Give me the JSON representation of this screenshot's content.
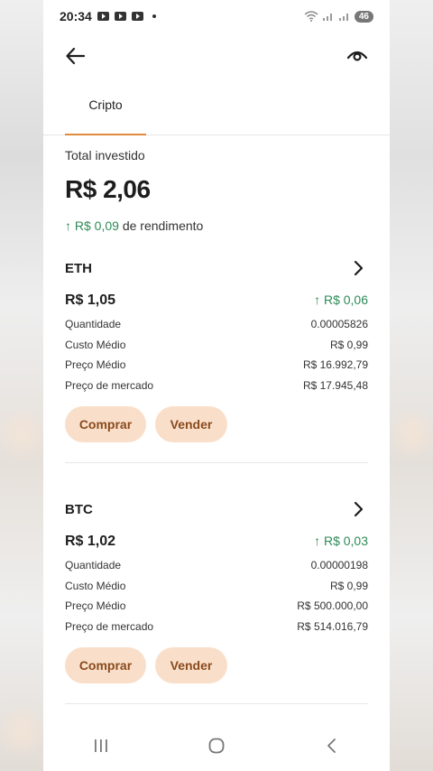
{
  "status": {
    "time": "20:34",
    "battery": "46"
  },
  "tabs": [
    {
      "label": "Cripto"
    }
  ],
  "summary": {
    "label": "Total investido",
    "value": "R$ 2,06",
    "yield_amount": "↑ R$ 0,09",
    "yield_suffix": "de rendimento"
  },
  "assets": [
    {
      "name": "ETH",
      "value": "R$ 1,05",
      "gain": "↑ R$ 0,06",
      "rows": [
        {
          "label": "Quantidade",
          "value": "0.00005826"
        },
        {
          "label": "Custo Médio",
          "value": "R$ 0,99"
        },
        {
          "label": "Preço Médio",
          "value": "R$ 16.992,79"
        },
        {
          "label": "Preço de mercado",
          "value": "R$ 17.945,48"
        }
      ],
      "buy_label": "Comprar",
      "sell_label": "Vender"
    },
    {
      "name": "BTC",
      "value": "R$ 1,02",
      "gain": "↑ R$ 0,03",
      "rows": [
        {
          "label": "Quantidade",
          "value": "0.00000198"
        },
        {
          "label": "Custo Médio",
          "value": "R$ 0,99"
        },
        {
          "label": "Preço Médio",
          "value": "R$ 500.000,00"
        },
        {
          "label": "Preço de mercado",
          "value": "R$ 514.016,79"
        }
      ],
      "buy_label": "Comprar",
      "sell_label": "Vender"
    }
  ],
  "colors": {
    "accent": "#e08a3c",
    "positive": "#2e8b57",
    "button_bg": "#f9dfca",
    "button_text": "#8a4a1c"
  },
  "icons": {
    "back": "arrow-left-icon",
    "visibility": "eye-icon",
    "details": "chevron-right-icon"
  }
}
